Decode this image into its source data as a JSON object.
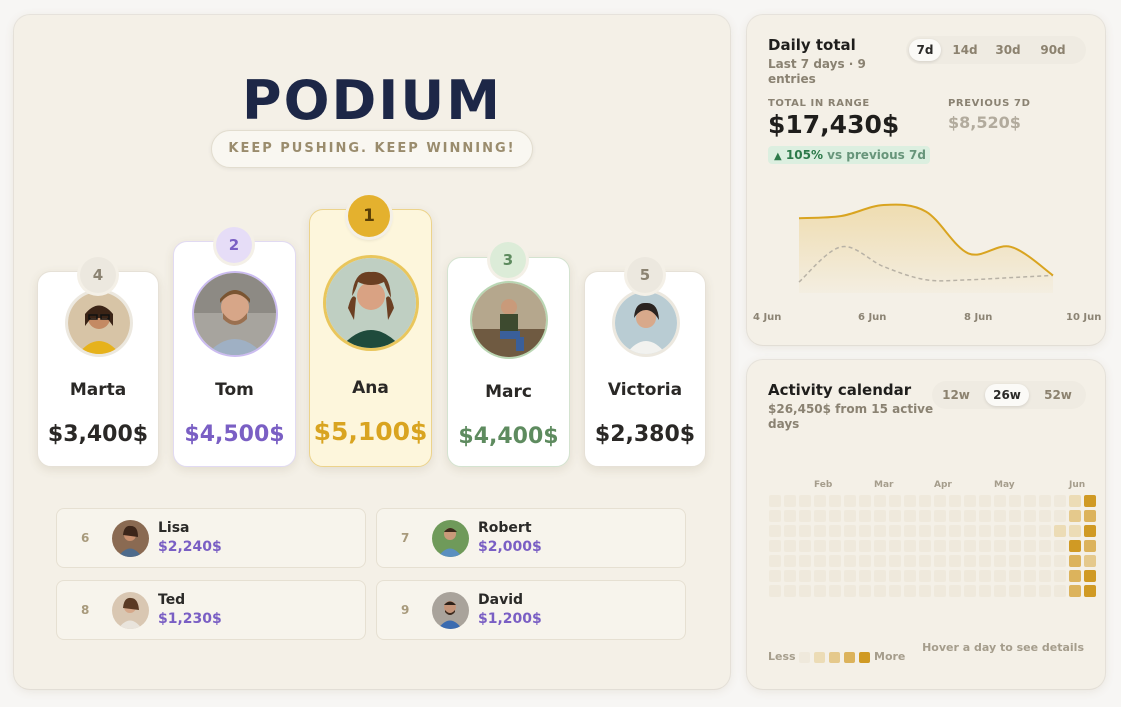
{
  "podium": {
    "title": "PODIUM",
    "subtitle": "KEEP PUSHING. KEEP WINNING!",
    "top5": [
      {
        "rank": "4",
        "name": "Marta",
        "amount": "$3,400$",
        "accent": "#2a2826"
      },
      {
        "rank": "2",
        "name": "Tom",
        "amount": "$4,500$",
        "accent": "#7a5fc4"
      },
      {
        "rank": "1",
        "name": "Ana",
        "amount": "$5,100$",
        "accent": "#d9a420"
      },
      {
        "rank": "3",
        "name": "Marc",
        "amount": "$4,400$",
        "accent": "#5e8b5f"
      },
      {
        "rank": "5",
        "name": "Victoria",
        "amount": "$2,380$",
        "accent": "#2a2826"
      }
    ],
    "others": [
      {
        "rank": "6",
        "name": "Lisa",
        "amount": "$2,240$"
      },
      {
        "rank": "7",
        "name": "Robert",
        "amount": "$2,000$"
      },
      {
        "rank": "8",
        "name": "Ted",
        "amount": "$1,230$"
      },
      {
        "rank": "9",
        "name": "David",
        "amount": "$1,200$"
      }
    ]
  },
  "daily": {
    "title": "Daily total",
    "subtitle_line1": "Last 7 days · 9",
    "subtitle_line2": "entries",
    "ranges": [
      "7d",
      "14d",
      "30d",
      "90d"
    ],
    "active_range": "7d",
    "total_label": "TOTAL IN RANGE",
    "total_value": "$17,430$",
    "prev_label": "PREVIOUS 7D",
    "prev_value": "$8,520$",
    "delta_arrow": "▲",
    "delta_value": "105%",
    "delta_text": "vs previous 7d",
    "colors": {
      "current": "#d9a420",
      "previous": "#b8b2a6",
      "positive": "#2d7a4a"
    }
  },
  "chart_data": {
    "type": "line",
    "x": [
      "4 Jun",
      "5 Jun",
      "6 Jun",
      "7 Jun",
      "8 Jun",
      "9 Jun",
      "10 Jun"
    ],
    "x_ticks": [
      "4 Jun",
      "6 Jun",
      "8 Jun",
      "10 Jun"
    ],
    "series": [
      {
        "values": [
          3400,
          3500,
          4000,
          3700,
          1800,
          2100,
          800
        ]
      },
      {
        "values": [
          500,
          2100,
          1200,
          600,
          600,
          700,
          800
        ]
      }
    ],
    "ylim": [
      0,
      5000
    ],
    "grid": false
  },
  "calendar": {
    "title": "Activity calendar",
    "subtitle_line1": "$26,450$ from 15 active",
    "subtitle_line2": "days",
    "ranges": [
      "12w",
      "26w",
      "52w"
    ],
    "active_range": "26w",
    "months": [
      "Feb",
      "Mar",
      "Apr",
      "May",
      "Jun"
    ],
    "legend_less": "Less",
    "legend_more": "More",
    "hint": "Hover a day to see details",
    "level_colors": [
      "#efe9dc",
      "#ecdcb6",
      "#e5c98c",
      "#dcb35c",
      "#d09a24"
    ],
    "active_cells": [
      {
        "week": 20,
        "day": 0,
        "level": 1
      },
      {
        "week": 20,
        "day": 1,
        "level": 2
      },
      {
        "week": 20,
        "day": 2,
        "level": 1
      },
      {
        "week": 20,
        "day": 3,
        "level": 4
      },
      {
        "week": 20,
        "day": 4,
        "level": 3
      },
      {
        "week": 20,
        "day": 5,
        "level": 3
      },
      {
        "week": 21,
        "day": 0,
        "level": 4
      },
      {
        "week": 21,
        "day": 1,
        "level": 3
      },
      {
        "week": 21,
        "day": 2,
        "level": 4
      },
      {
        "week": 21,
        "day": 3,
        "level": 3
      },
      {
        "week": 21,
        "day": 4,
        "level": 2
      },
      {
        "week": 21,
        "day": 5,
        "level": 4
      },
      {
        "week": 21,
        "day": 6,
        "level": 4
      },
      {
        "week": 20,
        "day": 6,
        "level": 3
      },
      {
        "week": 19,
        "day": 2,
        "level": 1
      }
    ]
  }
}
